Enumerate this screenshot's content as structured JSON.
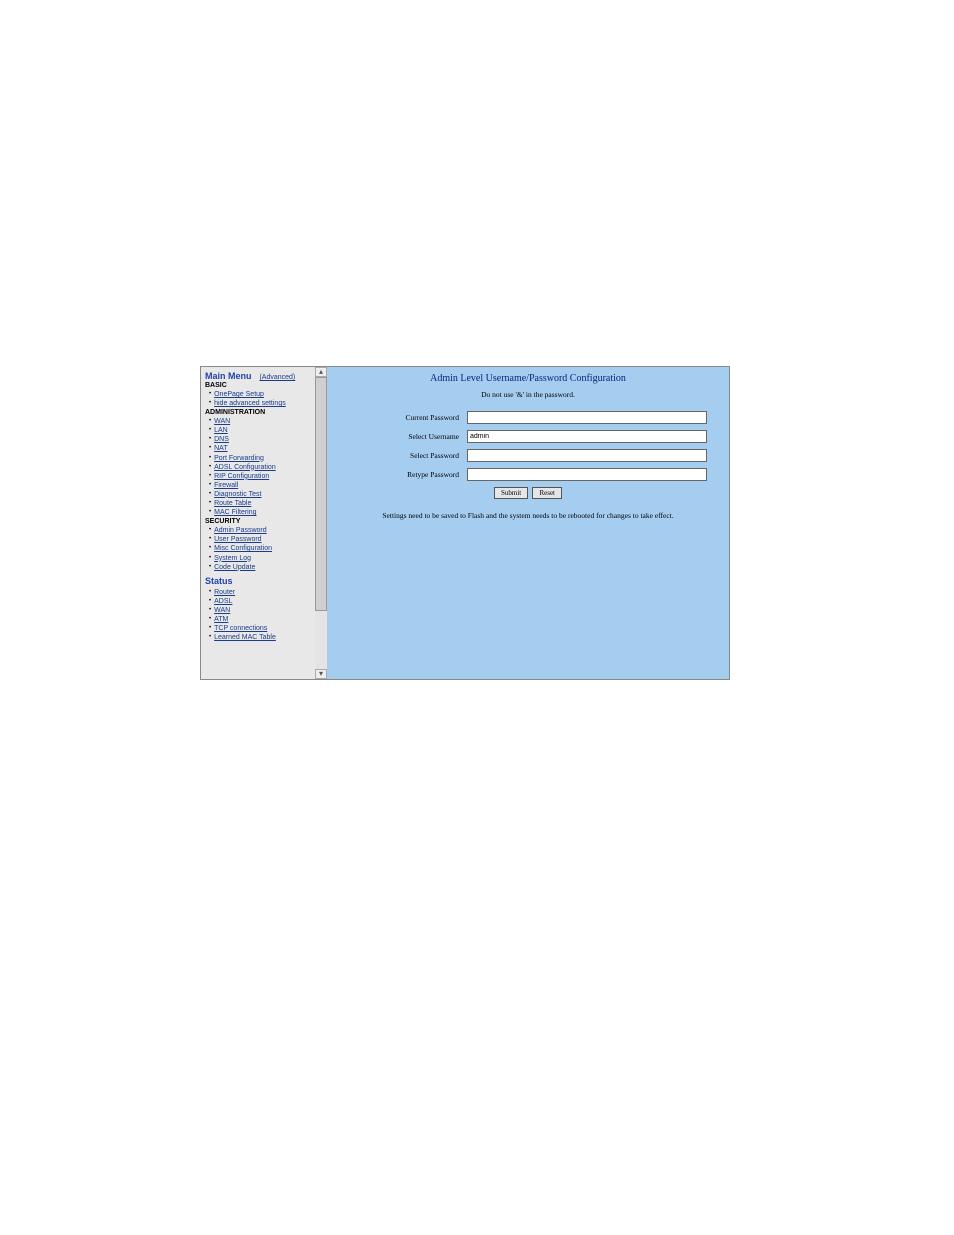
{
  "sidebar": {
    "title": "Main Menu",
    "title_link": "(Advanced)",
    "sections": {
      "basic": {
        "head": "BASIC",
        "items": [
          "OnePage Setup",
          "hide advanced settings"
        ]
      },
      "admin": {
        "head": "ADMINISTRATION",
        "items": [
          "WAN",
          "LAN",
          "DNS",
          "NAT",
          "Port Forwarding",
          "ADSL Configuration",
          "RIP Configuration",
          "Firewall",
          "Diagnostic Test",
          "Route Table",
          "MAC Filtering"
        ]
      },
      "security": {
        "head": "SECURITY",
        "items": [
          "Admin Password",
          "User Password",
          "Misc Configuration",
          "System Log",
          "Code Update"
        ]
      },
      "status": {
        "head": "Status",
        "items": [
          "Router",
          "ADSL",
          "WAN",
          "ATM",
          "TCP connections",
          "Learned MAC Table"
        ]
      }
    }
  },
  "content": {
    "title": "Admin Level Username/Password Configuration",
    "warning": "Do not use '&' in the password.",
    "labels": {
      "current_password": "Current Password",
      "select_username": "Select Username",
      "select_password": "Select Password",
      "retype_password": "Retype Password"
    },
    "values": {
      "current_password": "",
      "select_username": "admin",
      "select_password": "",
      "retype_password": ""
    },
    "buttons": {
      "submit": "Submit",
      "reset": "Reset"
    },
    "footnote": "Settings need to be saved to Flash and the system needs to be rebooted for changes to take effect."
  }
}
